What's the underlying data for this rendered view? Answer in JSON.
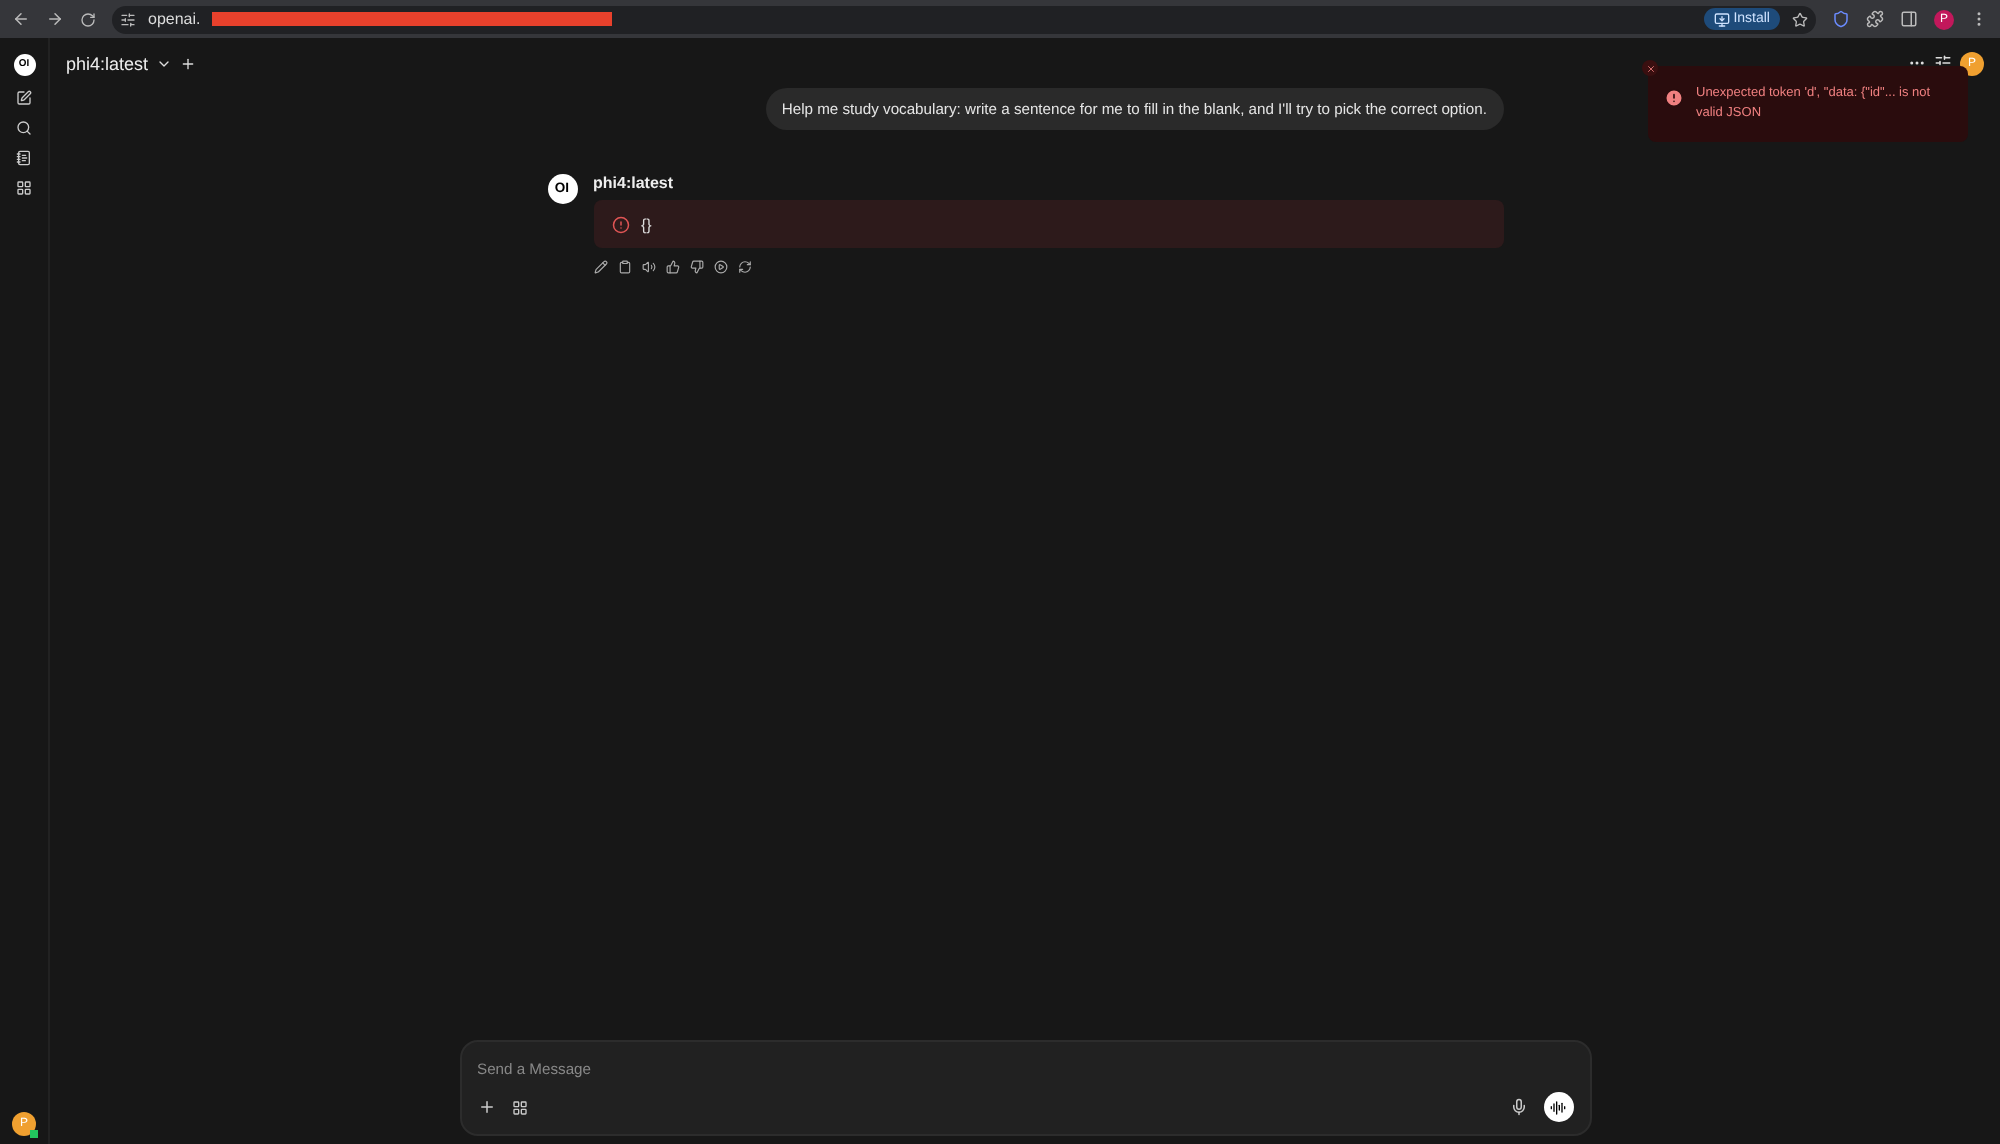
{
  "browser": {
    "url": "openai.",
    "install": "Install",
    "profile": "P"
  },
  "sidebar": {
    "logo": "OI",
    "user": "P",
    "online": true
  },
  "header": {
    "model": "phi4:latest",
    "avatar": "P"
  },
  "messages": [
    {
      "kind": "user",
      "text": "Help me study vocabulary: write a sentence for me to fill in the blank, and I'll try to pick the correct option."
    },
    {
      "kind": "assistant",
      "logo": "OI",
      "name": "phi4:latest",
      "error": "{}"
    }
  ],
  "toast": {
    "text": "Unexpected token 'd', \"data: {\"id\"... is not valid JSON"
  },
  "composer": {
    "placeholder": "Send a Message"
  }
}
